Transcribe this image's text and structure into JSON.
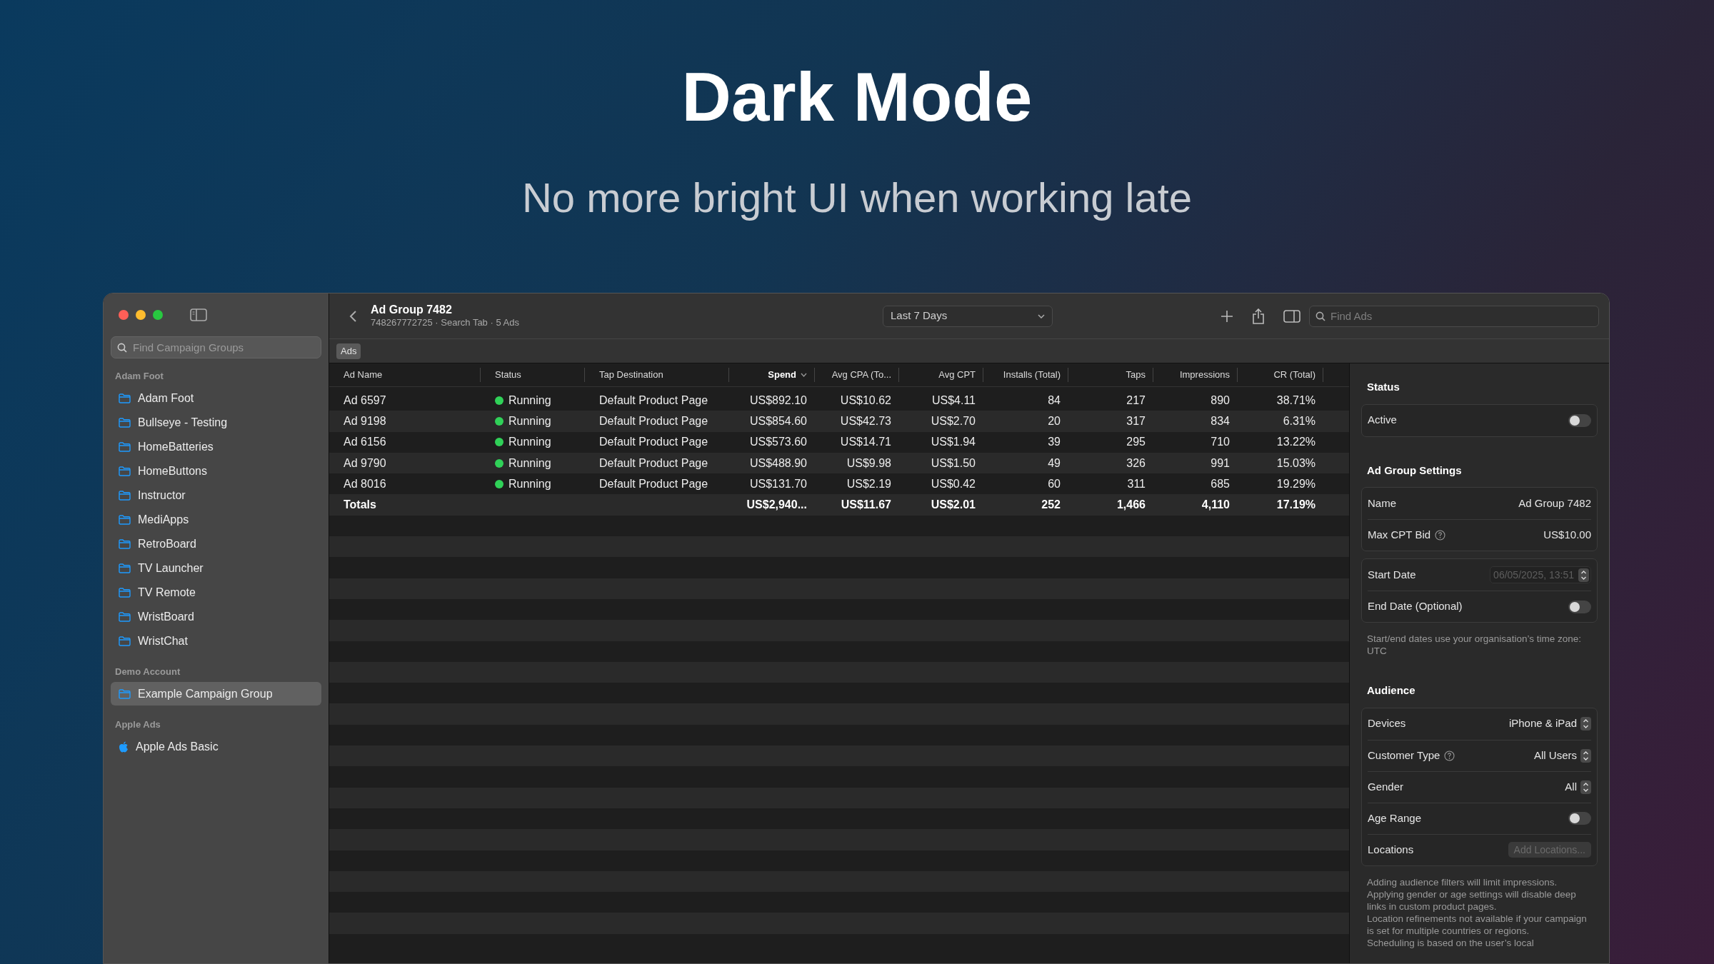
{
  "hero": {
    "title": "Dark Mode",
    "subtitle": "No more bright UI when working late"
  },
  "sidebar": {
    "search": {
      "placeholder": "Find Campaign Groups"
    },
    "sections": [
      {
        "title": "Adam Foot",
        "items": [
          {
            "label": "Adam Foot",
            "kind": "folder",
            "selected": false
          },
          {
            "label": "Bullseye - Testing",
            "kind": "folder",
            "selected": false
          },
          {
            "label": "HomeBatteries",
            "kind": "folder",
            "selected": false
          },
          {
            "label": "HomeButtons",
            "kind": "folder",
            "selected": false
          },
          {
            "label": "Instructor",
            "kind": "folder",
            "selected": false
          },
          {
            "label": "MediApps",
            "kind": "folder",
            "selected": false
          },
          {
            "label": "RetroBoard",
            "kind": "folder",
            "selected": false
          },
          {
            "label": "TV Launcher",
            "kind": "folder",
            "selected": false
          },
          {
            "label": "TV Remote",
            "kind": "folder",
            "selected": false
          },
          {
            "label": "WristBoard",
            "kind": "folder",
            "selected": false
          },
          {
            "label": "WristChat",
            "kind": "folder",
            "selected": false
          }
        ]
      },
      {
        "title": "Demo Account",
        "items": [
          {
            "label": "Example Campaign Group",
            "kind": "folder",
            "selected": true
          }
        ]
      },
      {
        "title": "Apple Ads",
        "items": [
          {
            "label": "Apple Ads Basic",
            "kind": "apple",
            "selected": false
          }
        ]
      }
    ]
  },
  "header": {
    "title": "Ad Group 7482",
    "subtitle": "748267772725 · Search Tab · 5 Ads",
    "date_range": "Last 7 Days",
    "search": {
      "placeholder": "Find Ads"
    }
  },
  "tabs": [
    {
      "label": "Ads",
      "selected": true
    }
  ],
  "table": {
    "columns": [
      {
        "label": "Ad Name",
        "sorted": false
      },
      {
        "label": "Status",
        "sorted": false
      },
      {
        "label": "Tap Destination",
        "sorted": false
      },
      {
        "label": "Spend",
        "sorted": true
      },
      {
        "label": "Avg CPA (To...",
        "sorted": false
      },
      {
        "label": "Avg CPT",
        "sorted": false
      },
      {
        "label": "Installs (Total)",
        "sorted": false
      },
      {
        "label": "Taps",
        "sorted": false
      },
      {
        "label": "Impressions",
        "sorted": false
      },
      {
        "label": "CR (Total)",
        "sorted": false
      }
    ],
    "rows": [
      {
        "cells": [
          "Ad 6597",
          "Running",
          "Default Product Page",
          "US$892.10",
          "US$10.62",
          "US$4.11",
          "84",
          "217",
          "890",
          "38.71%"
        ]
      },
      {
        "cells": [
          "Ad 9198",
          "Running",
          "Default Product Page",
          "US$854.60",
          "US$42.73",
          "US$2.70",
          "20",
          "317",
          "834",
          "6.31%"
        ]
      },
      {
        "cells": [
          "Ad 6156",
          "Running",
          "Default Product Page",
          "US$573.60",
          "US$14.71",
          "US$1.94",
          "39",
          "295",
          "710",
          "13.22%"
        ]
      },
      {
        "cells": [
          "Ad 9790",
          "Running",
          "Default Product Page",
          "US$488.90",
          "US$9.98",
          "US$1.50",
          "49",
          "326",
          "991",
          "15.03%"
        ]
      },
      {
        "cells": [
          "Ad 8016",
          "Running",
          "Default Product Page",
          "US$131.70",
          "US$2.19",
          "US$0.42",
          "60",
          "311",
          "685",
          "19.29%"
        ]
      }
    ],
    "totals": {
      "label": "Totals",
      "values": [
        "US$2,940...",
        "US$11.67",
        "US$2.01",
        "252",
        "1,466",
        "4,110",
        "17.19%"
      ]
    }
  },
  "inspector": {
    "sections": [
      {
        "title": "Status",
        "groups": [
          [
            {
              "kind": "toggle",
              "label": "Active",
              "help": false,
              "on": false
            }
          ]
        ]
      },
      {
        "title": "Ad Group Settings",
        "groups": [
          [
            {
              "kind": "value",
              "label": "Name",
              "help": false,
              "value": "Ad Group 7482"
            },
            {
              "kind": "value",
              "label": "Max CPT Bid",
              "help": true,
              "value": "US$10.00"
            }
          ],
          [
            {
              "kind": "date",
              "label": "Start Date",
              "help": false,
              "value": "06/05/2025, 13:51",
              "disabled": true
            },
            {
              "kind": "toggle",
              "label": "End Date (Optional)",
              "help": false,
              "on": false
            }
          ]
        ],
        "notes": [
          "Start/end dates use your organisation’s time zone: UTC"
        ]
      },
      {
        "title": "Audience",
        "groups": [
          [
            {
              "kind": "popup",
              "label": "Devices",
              "help": false,
              "value": "iPhone & iPad"
            },
            {
              "kind": "popup",
              "label": "Customer Type",
              "help": true,
              "value": "All Users"
            },
            {
              "kind": "popup",
              "label": "Gender",
              "help": false,
              "value": "All"
            },
            {
              "kind": "toggle",
              "label": "Age Range",
              "help": false,
              "on": false
            },
            {
              "kind": "button",
              "label": "Locations",
              "help": false,
              "value": "Add Locations...",
              "disabled": true
            }
          ]
        ],
        "notes": [
          "Adding audience filters will limit impressions. Applying gender or age settings will disable deep links in custom product pages.",
          "Location refinements not available if your campaign is set for multiple countries or regions.",
          "Scheduling is based on the user’s local"
        ]
      }
    ]
  }
}
